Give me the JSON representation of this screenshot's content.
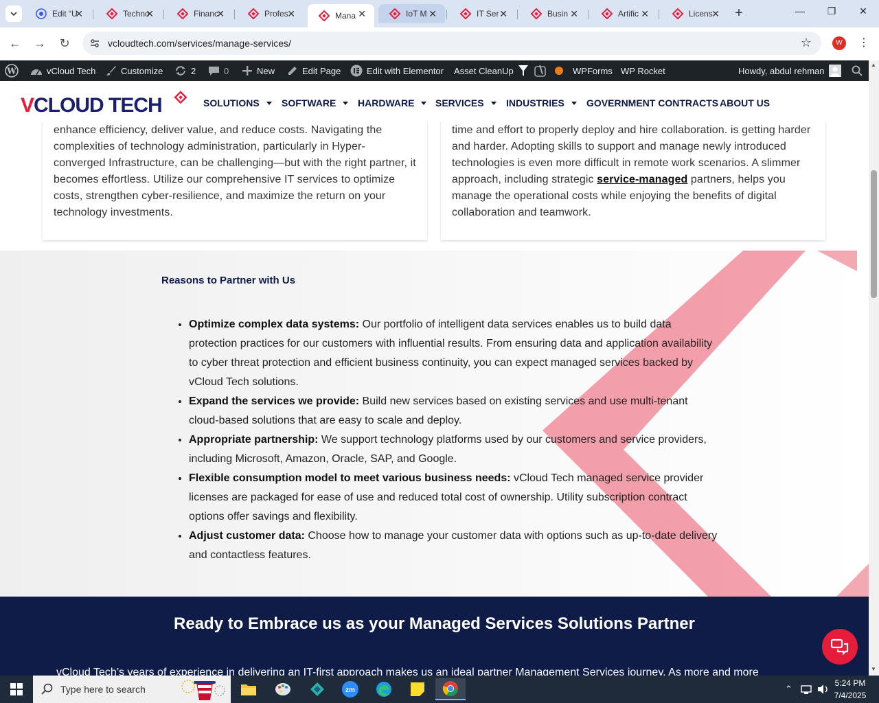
{
  "browser": {
    "tabs": [
      {
        "title": "Edit “U",
        "icon": "wordpress-icon"
      },
      {
        "title": "Techno",
        "icon": "vcloud-icon"
      },
      {
        "title": "Financ",
        "icon": "vcloud-icon"
      },
      {
        "title": "Profes",
        "icon": "vcloud-icon"
      },
      {
        "title": "Mana",
        "icon": "vcloud-icon",
        "active": true
      },
      {
        "title": "IoT M",
        "icon": "vcloud-icon"
      },
      {
        "title": "IT Ser",
        "icon": "vcloud-icon"
      },
      {
        "title": "Busin",
        "icon": "vcloud-icon"
      },
      {
        "title": "Artific",
        "icon": "vcloud-icon"
      },
      {
        "title": "Licens",
        "icon": "vcloud-icon"
      }
    ],
    "url": "vcloudtech.com/services/manage-services/",
    "profile_initial": "W"
  },
  "adminbar": {
    "site": "vCloud Tech",
    "customize": "Customize",
    "updates": "2",
    "comments": "0",
    "new": "New",
    "edit_page": "Edit Page",
    "elementor": "Edit with Elementor",
    "asset_cleanup": "Asset CleanUp",
    "wpforms": "WPForms",
    "wprocket": "WP Rocket",
    "howdy": "Howdy, abdul rehman"
  },
  "nav": {
    "logo_text": "VCLOUD TECH",
    "items": [
      "SOLUTIONS",
      "SOFTWARE",
      "HARDWARE",
      "SERVICES",
      "INDUSTRIES",
      "GOVERNMENT CONTRACTS",
      "ABOUT US"
    ]
  },
  "cards": {
    "left_text": "enhance efficiency, deliver value, and reduce costs. Navigating the complexities of technology administration, particularly in Hyper-converged Infrastructure, can be challenging—but with the right partner, it becomes effortless. Utilize our comprehensive IT services to optimize costs, strengthen cyber-resilience, and maximize the return on your technology investments.",
    "right_text_before": "time and effort to properly deploy and hire collaboration. is getting harder and harder. Adopting skills to support and manage newly introduced technologies is even more difficult in remote work scenarios. A slimmer approach, including strategic ",
    "right_link": "service-managed",
    "right_text_after": " partners, helps you manage the operational costs while enjoying the benefits of digital collaboration and teamwork."
  },
  "reasons": {
    "title": "Reasons to Partner with Us",
    "items": [
      {
        "bold": "Optimize complex data systems:",
        "text": " Our portfolio of intelligent data services enables us to build data protection practices for our customers with influential results. From ensuring data and application availability to cyber threat protection and efficient business continuity, you can expect managed services backed by vCloud Tech solutions."
      },
      {
        "bold": "Expand the services we provide:",
        "text": " Build new services based on existing services and use multi-tenant cloud-based solutions that are easy to scale and deploy."
      },
      {
        "bold": "Appropriate partnership:",
        "text": " We support technology platforms used by our customers and service providers, including Microsoft, Amazon, Oracle, SAP, and Google."
      },
      {
        "bold": "Flexible consumption model to meet various business needs:",
        "text": " vCloud Tech managed service provider licenses are packaged for ease of use and reduced total cost of ownership. Utility subscription contract options offer savings and flexibility."
      },
      {
        "bold": "Adjust customer data:",
        "text": " Choose how to manage your customer data with options such as up-to-date delivery and contactless features."
      }
    ]
  },
  "cta": {
    "title": "Ready to Embrace us as your Managed Services Solutions Partner",
    "text": "vCloud Tech’s years of experience in delivering an IT-first approach makes us an ideal partner Management Services journey. As more and more"
  },
  "taskbar": {
    "search_placeholder": "Type here to search",
    "time": "5:24 PM",
    "date": "7/4/2025"
  },
  "colors": {
    "accent_red": "#e51c3a",
    "navy": "#0f1c47",
    "admin_bar": "#1d2327"
  }
}
